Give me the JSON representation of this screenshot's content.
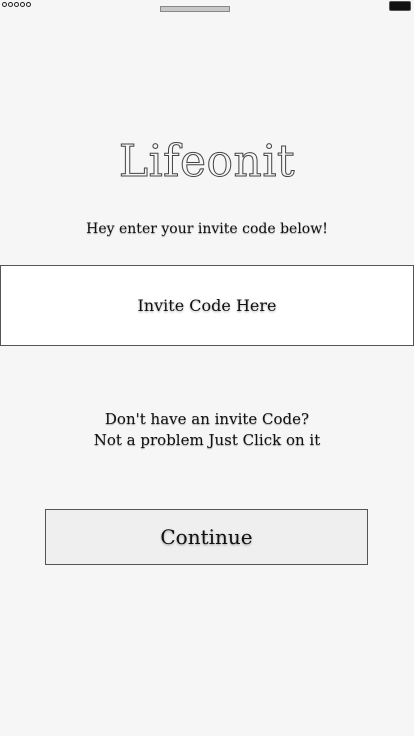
{
  "app": {
    "logo_text": "Lifeonit"
  },
  "status_bar": {
    "signal_icon": "signal-dots-icon",
    "battery_icon": "battery-icon"
  },
  "invite": {
    "prompt": "Hey enter your invite code below!",
    "placeholder": "Invite Code Here",
    "value": ""
  },
  "no_invite": {
    "line1": "Don't have an invite Code?",
    "line2": "Not a problem Just Click on it"
  },
  "actions": {
    "continue_label": "Continue"
  },
  "colors": {
    "background": "#f6f6f6",
    "border": "#555555"
  }
}
